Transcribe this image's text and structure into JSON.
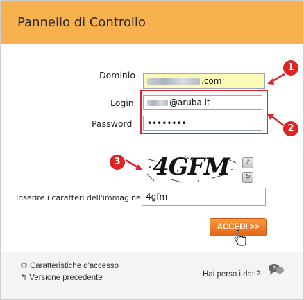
{
  "header": {
    "title": "Pannello di Controllo"
  },
  "form": {
    "dominio_label": "Dominio",
    "dominio_value": ".com",
    "login_label": "Login",
    "login_value": "@aruba.it",
    "password_label": "Password",
    "password_value": "••••••••",
    "captcha_text": "4GFM",
    "captcha_label": "Inserire i caratteri dell'immagine",
    "captcha_value": "4gfm",
    "submit_label": "ACCEDI >>"
  },
  "annotations": [
    "1",
    "2",
    "3"
  ],
  "footer": {
    "access_features": "Caratteristiche d'accesso",
    "previous_version": "Versione precedente",
    "lost_data": "Hai perso i dati?"
  },
  "colors": {
    "header": "#f8b14f",
    "accent_red": "#d9252b",
    "button": "#ef7d27",
    "dominio_bg": "#fafbb8"
  },
  "icons": [
    "arrow-right-icon",
    "refresh-icon",
    "audio-icon",
    "gear-icon",
    "back-arrow-icon",
    "chat-bubbles-icon",
    "hand-cursor-icon"
  ]
}
